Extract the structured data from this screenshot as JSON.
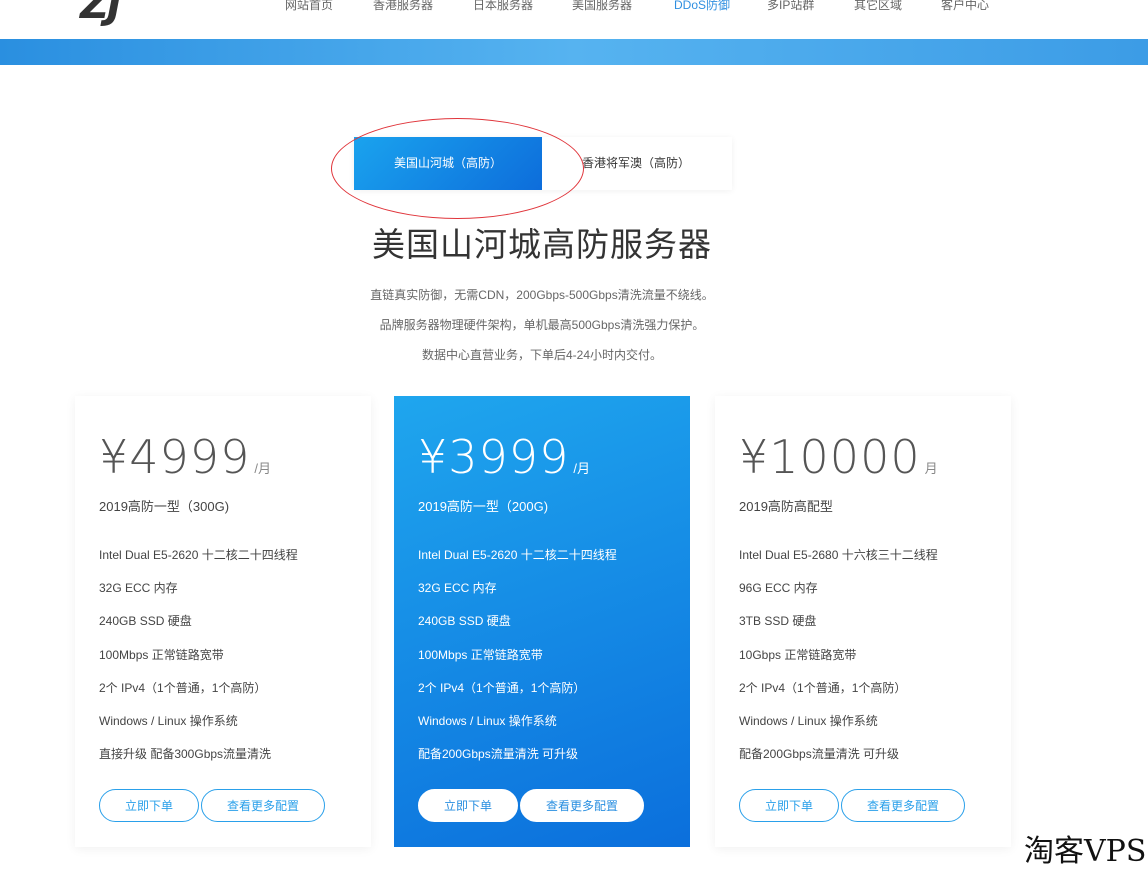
{
  "header": {
    "logo": "ZJ",
    "nav": [
      {
        "label": "网站首页",
        "active": false
      },
      {
        "label": "香港服务器",
        "active": false
      },
      {
        "label": "日本服务器",
        "active": false
      },
      {
        "label": "美国服务器",
        "active": false
      },
      {
        "label": "DDoS防御",
        "active": true
      },
      {
        "label": "多IP站群",
        "active": false
      },
      {
        "label": "其它区域",
        "active": false
      },
      {
        "label": "客户中心",
        "active": false
      }
    ]
  },
  "tabs": [
    {
      "label": "美国山河城（高防）",
      "active": true
    },
    {
      "label": "香港将军澳（高防）",
      "active": false
    }
  ],
  "main": {
    "title": "美国山河城高防服务器",
    "desc": [
      "直链真实防御，无需CDN，200Gbps-500Gbps清洗流量不绕线。",
      "品牌服务器物理硬件架构，单机最高500Gbps清洗强力保护。",
      "数据中心直营业务，下单后4-24小时内交付。"
    ]
  },
  "plans": [
    {
      "price": "¥4999",
      "per": "/月",
      "name": "2019高防一型（300G)",
      "specs": [
        "Intel Dual E5-2620 十二核二十四线程",
        "32G ECC 内存",
        "240GB SSD 硬盘",
        "100Mbps 正常链路宽带",
        "2个 IPv4（1个普通，1个高防）",
        "Windows / Linux 操作系统",
        "直接升级 配备300Gbps流量清洗"
      ],
      "order_label": "立即下单",
      "more_label": "查看更多配置"
    },
    {
      "price": "¥3999",
      "per": "/月",
      "name": "2019高防一型（200G)",
      "specs": [
        "Intel Dual E5-2620 十二核二十四线程",
        "32G ECC 内存",
        "240GB SSD 硬盘",
        "100Mbps 正常链路宽带",
        "2个 IPv4（1个普通，1个高防）",
        "Windows / Linux 操作系统",
        "配备200Gbps流量清洗 可升级"
      ],
      "order_label": "立即下单",
      "more_label": "查看更多配置"
    },
    {
      "price": "¥10000",
      "per": "月",
      "name": "2019高防高配型",
      "specs": [
        "Intel Dual E5-2680 十六核三十二线程",
        "96G ECC 内存",
        "3TB SSD 硬盘",
        "10Gbps 正常链路宽带",
        "2个 IPv4（1个普通，1个高防）",
        "Windows / Linux 操作系统",
        "配备200Gbps流量清洗 可升级"
      ],
      "order_label": "立即下单",
      "more_label": "查看更多配置"
    }
  ],
  "watermark": "淘客VPS",
  "colors": {
    "accent": "#2a8fe0",
    "gradient_start": "#1fa6ee",
    "gradient_end": "#0b6fdc",
    "annotation": "#e0353b"
  }
}
